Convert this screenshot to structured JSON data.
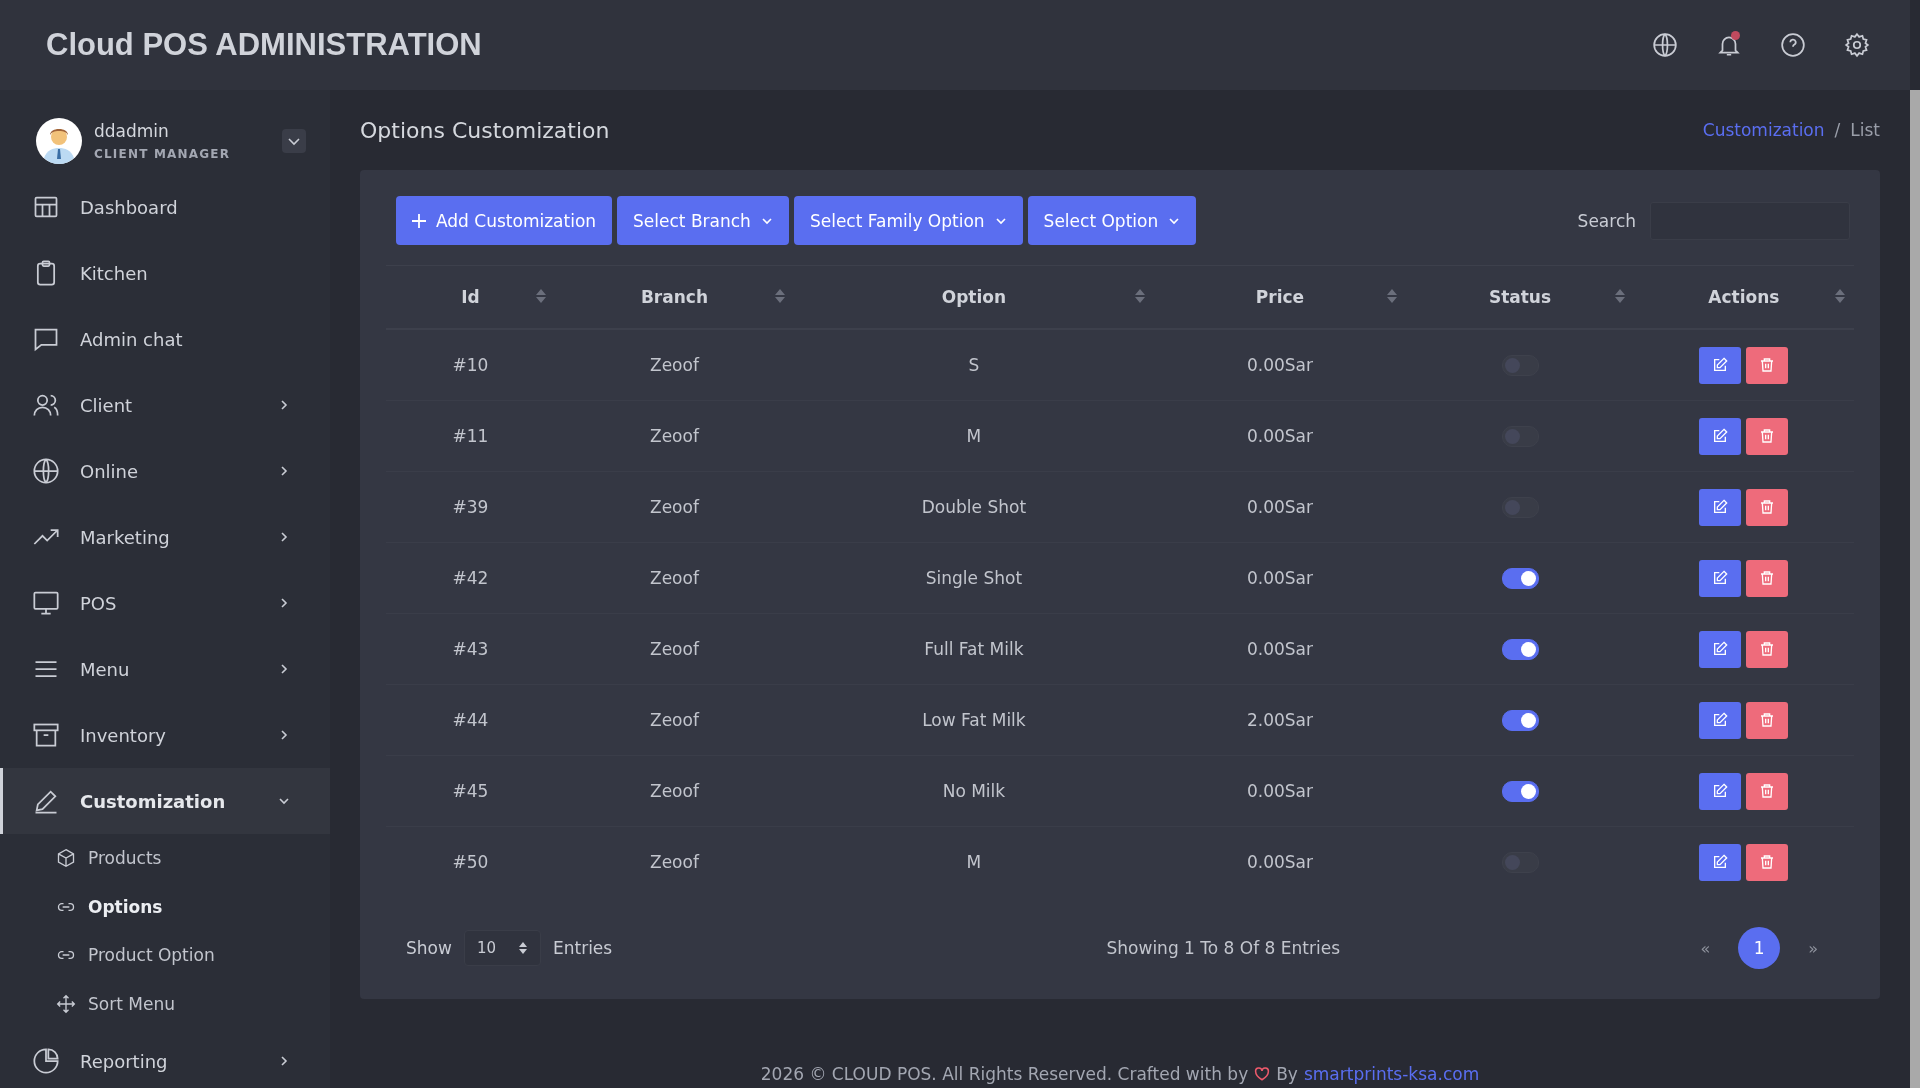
{
  "header": {
    "title": "Cloud POS ADMINISTRATION",
    "notification_dot": true
  },
  "user": {
    "name": "ddadmin",
    "role": "CLIENT MANAGER"
  },
  "sidebar": {
    "items": [
      {
        "label": "Dashboard",
        "kind": "link",
        "selected": false,
        "expanded": false
      },
      {
        "label": "Kitchen",
        "kind": "link",
        "selected": false,
        "expanded": false
      },
      {
        "label": "Admin chat",
        "kind": "link",
        "selected": false,
        "expanded": false
      },
      {
        "label": "Client",
        "kind": "group",
        "selected": false,
        "expanded": false
      },
      {
        "label": "Online",
        "kind": "group",
        "selected": false,
        "expanded": false
      },
      {
        "label": "Marketing",
        "kind": "group",
        "selected": false,
        "expanded": false
      },
      {
        "label": "POS",
        "kind": "group",
        "selected": false,
        "expanded": false
      },
      {
        "label": "Menu",
        "kind": "group",
        "selected": false,
        "expanded": false
      },
      {
        "label": "Inventory",
        "kind": "group",
        "selected": false,
        "expanded": false
      },
      {
        "label": "Customization",
        "kind": "group",
        "selected": true,
        "expanded": true,
        "children": [
          {
            "label": "Products",
            "selected": false
          },
          {
            "label": "Options",
            "selected": true
          },
          {
            "label": "Product Option",
            "selected": false
          },
          {
            "label": "Sort Menu",
            "selected": false
          }
        ]
      },
      {
        "label": "Reporting",
        "kind": "group",
        "selected": false,
        "expanded": false
      }
    ]
  },
  "page": {
    "title": "Options Customization",
    "breadcrumb_separator": "/",
    "breadcrumb": [
      {
        "label": "Customization",
        "kind": "link"
      },
      {
        "label": "List",
        "kind": "current"
      }
    ]
  },
  "toolbar": {
    "buttons": [
      {
        "label": "Add Customization",
        "kind": "add"
      },
      {
        "label": "Select Branch",
        "kind": "dropdown"
      },
      {
        "label": "Select Family Option",
        "kind": "dropdown"
      },
      {
        "label": "Select Option",
        "kind": "dropdown"
      }
    ],
    "search": {
      "label": "Search"
    }
  },
  "table": {
    "columns": [
      "Id",
      "Branch",
      "Option",
      "Price",
      "Status",
      "Actions"
    ],
    "rows": [
      {
        "id": "#10",
        "branch": "Zeoof",
        "option": "S",
        "price": "0.00Sar",
        "on": false
      },
      {
        "id": "#11",
        "branch": "Zeoof",
        "option": "M",
        "price": "0.00Sar",
        "on": false
      },
      {
        "id": "#39",
        "branch": "Zeoof",
        "option": "Double Shot",
        "price": "0.00Sar",
        "on": false
      },
      {
        "id": "#42",
        "branch": "Zeoof",
        "option": "Single Shot",
        "price": "0.00Sar",
        "on": true
      },
      {
        "id": "#43",
        "branch": "Zeoof",
        "option": "Full Fat Milk",
        "price": "0.00Sar",
        "on": true
      },
      {
        "id": "#44",
        "branch": "Zeoof",
        "option": "Low Fat Milk",
        "price": "2.00Sar",
        "on": true
      },
      {
        "id": "#45",
        "branch": "Zeoof",
        "option": "No Milk",
        "price": "0.00Sar",
        "on": true
      },
      {
        "id": "#50",
        "branch": "Zeoof",
        "option": "M",
        "price": "0.00Sar",
        "on": false
      }
    ]
  },
  "pager": {
    "show": "Show",
    "page_size": "10",
    "entries": "Entries",
    "summary": "Showing 1 To 8 Of 8 Entries",
    "prev": "«",
    "next": "»",
    "pages": [
      {
        "label": "1",
        "selected": true
      }
    ]
  },
  "footer": {
    "text": "2026 © CLOUD POS. All Rights Reserved. Crafted with by",
    "by": "By",
    "link": "smartprints-ksa.com"
  }
}
